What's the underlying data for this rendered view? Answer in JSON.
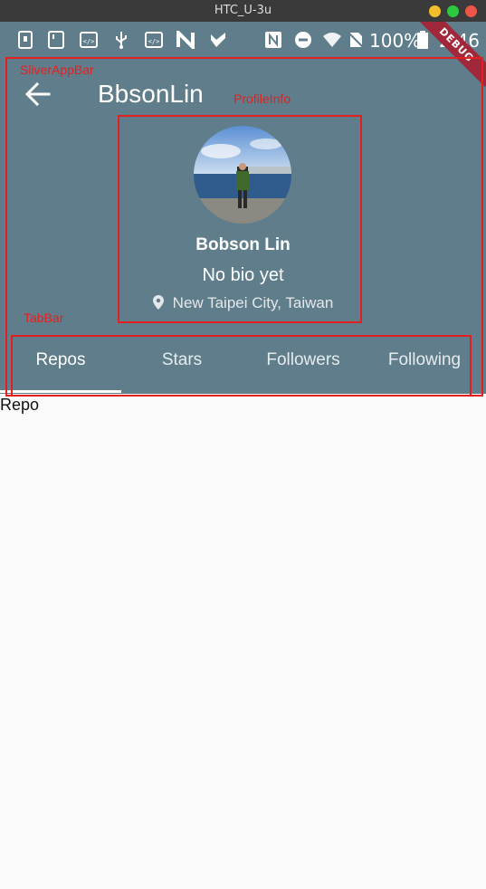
{
  "window": {
    "title": "HTC_U-3u"
  },
  "status_bar": {
    "icons": [
      "sim-icon",
      "sd-icon",
      "code-icon",
      "usb-icon",
      "code-icon",
      "n-icon",
      "check-icon",
      "nfc-icon",
      "dnd-icon",
      "wifi-icon",
      "no-sim-icon",
      "battery-icon"
    ],
    "battery": "100%",
    "time": "2:46",
    "debug_banner": "DEBUG"
  },
  "app_bar": {
    "title": "BbsonLin"
  },
  "profile": {
    "name": "Bobson Lin",
    "bio": "No bio yet",
    "location": "New Taipei City, Taiwan"
  },
  "tabs": [
    {
      "label": "Repos",
      "selected": true
    },
    {
      "label": "Stars",
      "selected": false
    },
    {
      "label": "Followers",
      "selected": false
    },
    {
      "label": "Following",
      "selected": false
    }
  ],
  "content": {
    "text": "Repo"
  },
  "annotations": {
    "sliver_app_bar": "SliverAppBar",
    "profile_info": "ProfileInfo",
    "tab_bar": "TabBar"
  },
  "colors": {
    "app_bar": "#607d8b",
    "annotation": "#e32020",
    "background": "#fafafa"
  }
}
